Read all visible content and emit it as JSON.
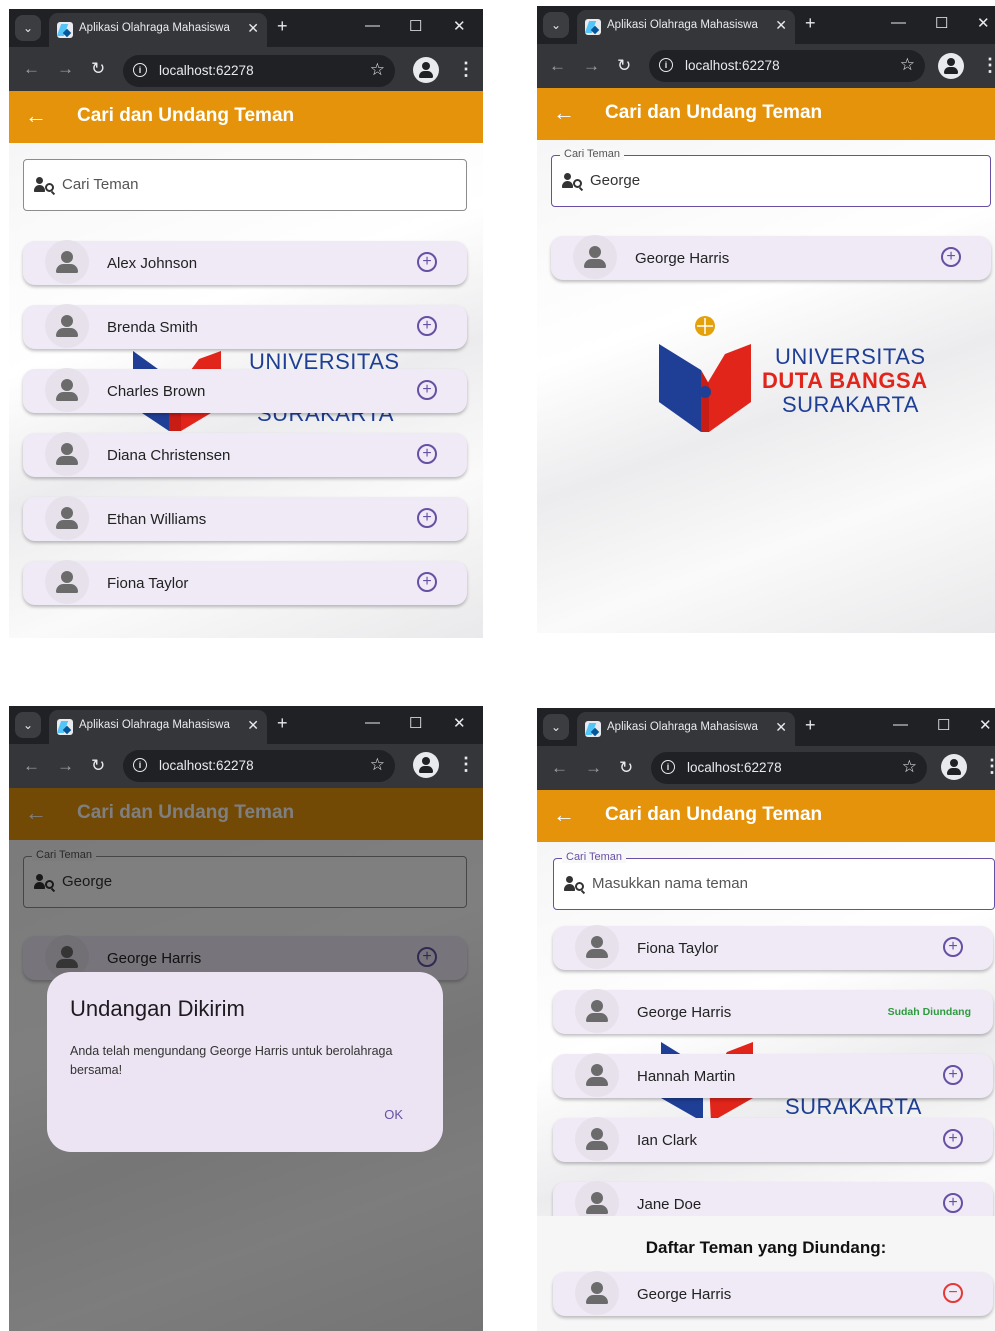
{
  "browser": {
    "tab_title": "Aplikasi Olahraga Mahasiswa",
    "tab_close": "✕",
    "new_tab": "+",
    "url": "localhost:62278"
  },
  "appbar": {
    "title": "Cari dan Undang Teman",
    "back": "←"
  },
  "search": {
    "label": "Cari Teman",
    "placeholder_1": "Cari Teman",
    "value": "George",
    "placeholder_2": "Masukkan nama teman"
  },
  "logo": {
    "line1": "UNIVERSITAS",
    "line2": "DUTA BANGSA",
    "line3": "SURAKARTA"
  },
  "panel1": {
    "friends": [
      "Alex Johnson",
      "Brenda Smith",
      "Charles Brown",
      "Diana Christensen",
      "Ethan Williams",
      "Fiona Taylor"
    ]
  },
  "panel2": {
    "friends": [
      "George Harris"
    ]
  },
  "panel3": {
    "friends": [
      "George Harris"
    ],
    "dialog": {
      "title": "Undangan Dikirim",
      "body": "Anda telah mengundang George Harris untuk berolahraga bersama!",
      "ok": "OK"
    }
  },
  "panel4": {
    "friends": [
      "Fiona Taylor",
      "George Harris",
      "Hannah Martin",
      "Ian Clark",
      "Jane Doe"
    ],
    "invited_badge": "Sudah Diundang",
    "invited_title": "Daftar Teman yang Diundang:",
    "invited": [
      "George Harris"
    ]
  },
  "colors": {
    "appbar": "#e5930a",
    "accent": "#6750a4",
    "remove": "#e53935",
    "badge": "#2e9b3e"
  }
}
